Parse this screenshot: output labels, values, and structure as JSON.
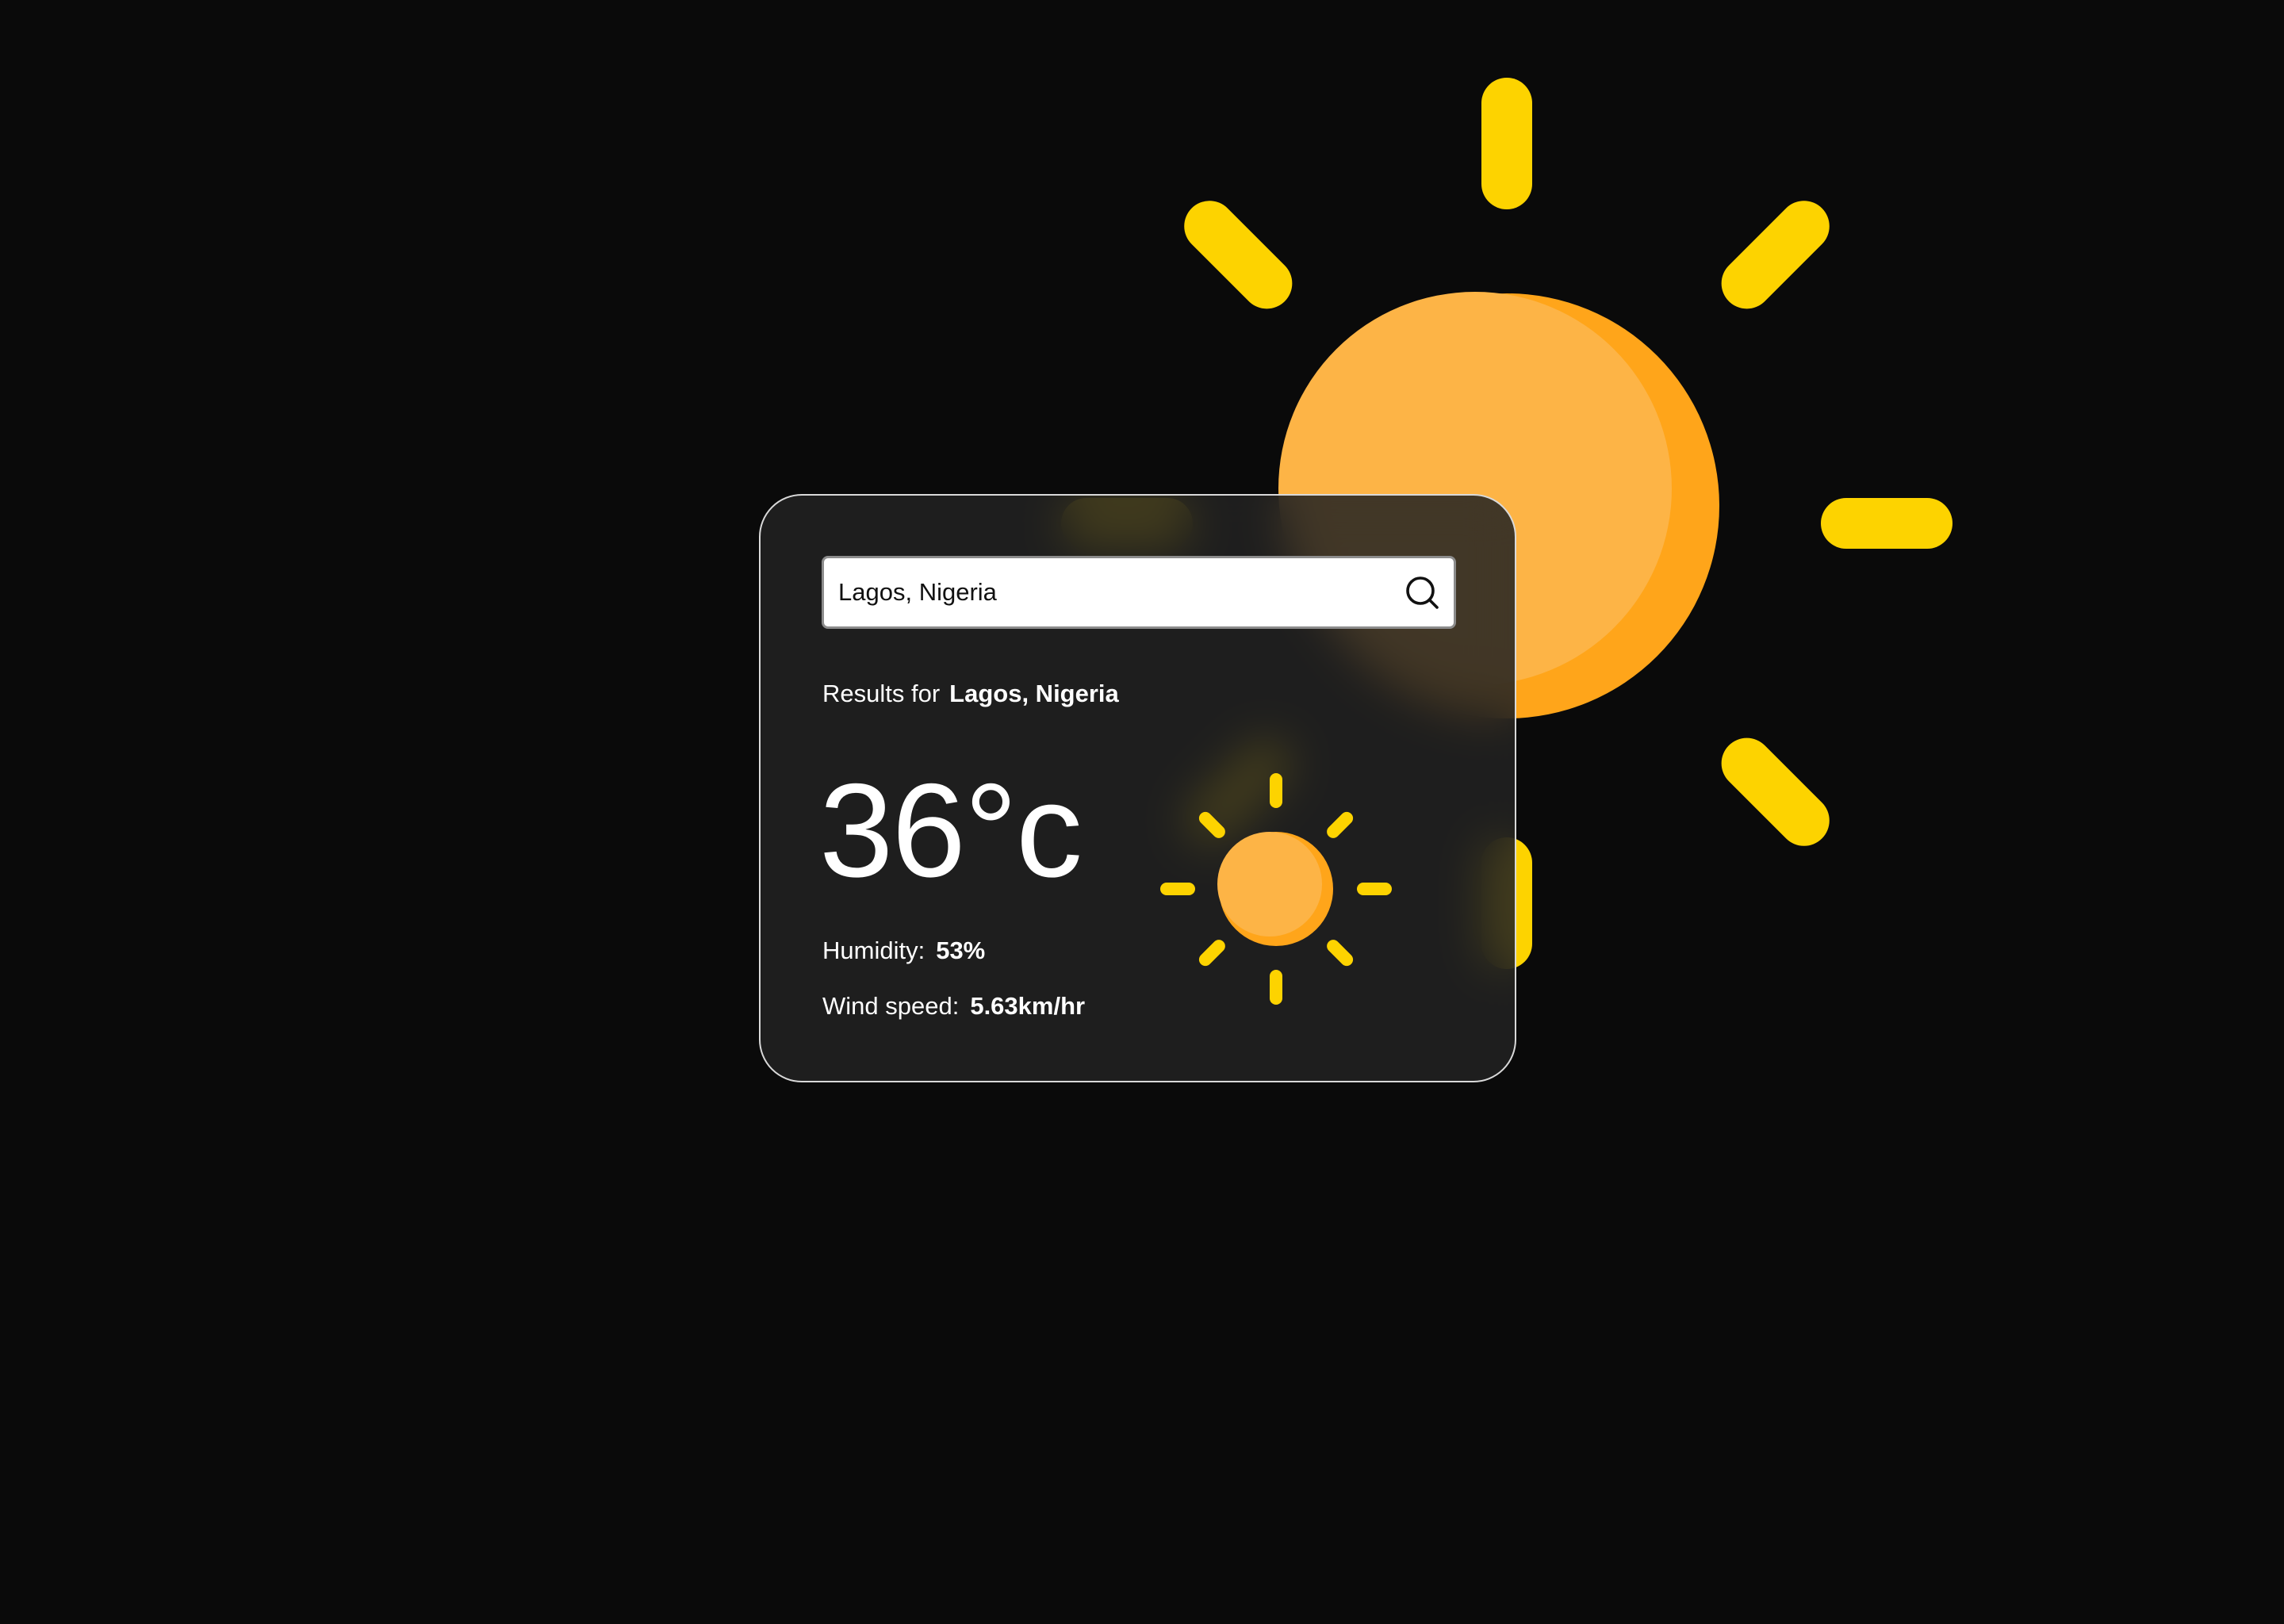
{
  "search": {
    "value": "Lagos, Nigeria",
    "placeholder": ""
  },
  "results": {
    "prefix": "Results for",
    "city": "Lagos, Nigeria"
  },
  "weather": {
    "temperature": "36°c",
    "humidity_label": "Humidity:",
    "humidity_value": "53%",
    "wind_label": "Wind speed:",
    "wind_value": "5.63km/hr",
    "condition_icon": "sun-icon"
  },
  "icons": {
    "search": "search-icon",
    "background": "sun-icon"
  },
  "colors": {
    "background": "#0a0a0a",
    "card": "#222222",
    "card_border": "#d9d9d9",
    "sun_body": "#fdb446",
    "sun_shade": "#ffa51a",
    "sun_rays": "#fdd300",
    "text": "#ffffff"
  }
}
